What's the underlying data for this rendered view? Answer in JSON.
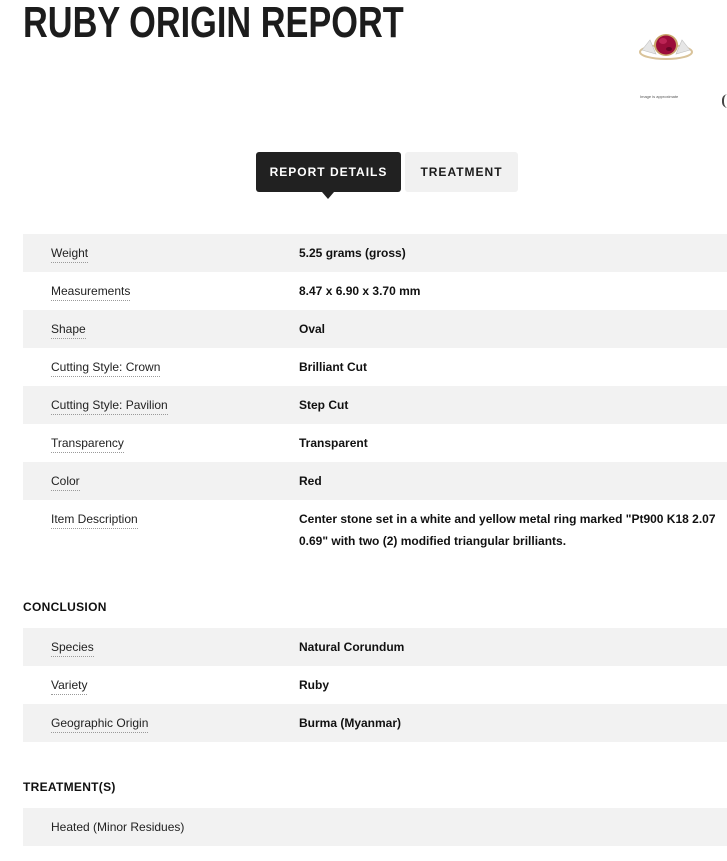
{
  "header": {
    "title": "RUBY ORIGIN REPORT",
    "image_caption": "Image is approximate"
  },
  "tabs": [
    {
      "label": "REPORT DETAILS",
      "active": true
    },
    {
      "label": "TREATMENT",
      "active": false
    }
  ],
  "details": [
    {
      "label": "Weight",
      "value": "5.25 grams (gross)"
    },
    {
      "label": "Measurements",
      "value": "8.47 x 6.90 x 3.70 mm"
    },
    {
      "label": "Shape",
      "value": "Oval"
    },
    {
      "label": "Cutting Style: Crown",
      "value": "Brilliant Cut"
    },
    {
      "label": "Cutting Style: Pavilion",
      "value": "Step Cut"
    },
    {
      "label": "Transparency",
      "value": "Transparent"
    },
    {
      "label": "Color",
      "value": "Red"
    },
    {
      "label": "Item Description",
      "value": "Center stone set in a white and yellow metal ring marked \"Pt900 K18 2.07 0.69\" with two (2) modified triangular brilliants."
    }
  ],
  "conclusion": {
    "heading": "CONCLUSION",
    "rows": [
      {
        "label": "Species",
        "value": "Natural Corundum"
      },
      {
        "label": "Variety",
        "value": "Ruby"
      },
      {
        "label": "Geographic Origin",
        "value": "Burma (Myanmar)"
      }
    ]
  },
  "treatments": {
    "heading": "TREATMENT(S)",
    "rows": [
      {
        "label": "Heated (Minor Residues)"
      }
    ]
  },
  "colors": {
    "active_tab_bg": "#212121",
    "inactive_tab_bg": "#f1f1f1",
    "row_alt_bg": "#f2f2f2",
    "ruby": "#9b0d3a"
  }
}
